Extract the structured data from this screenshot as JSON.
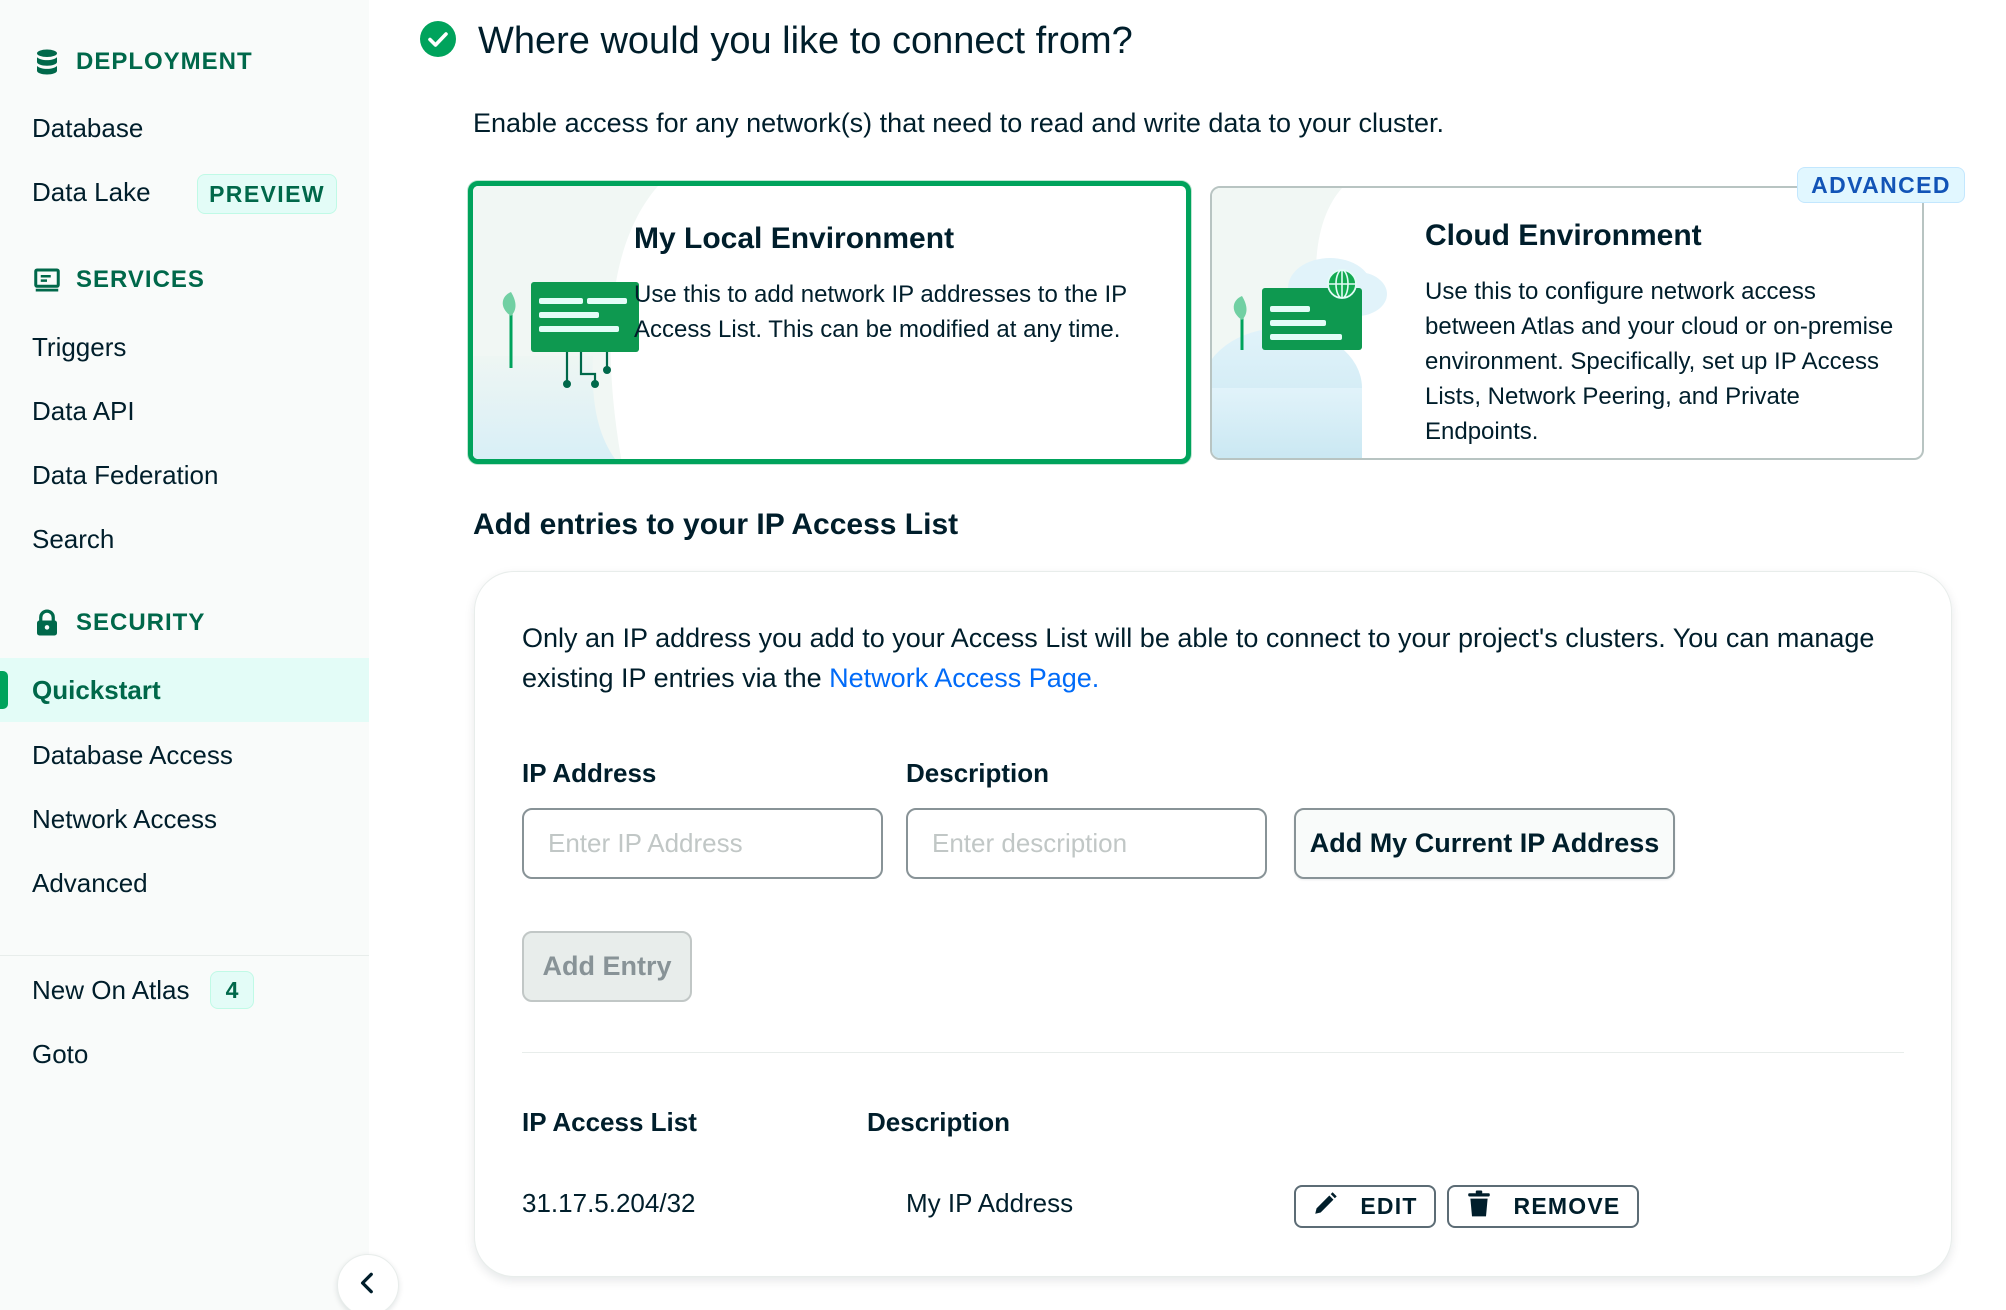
{
  "sidebar": {
    "sections": [
      {
        "label": "DEPLOYMENT",
        "icon": "database-stack-icon"
      },
      {
        "label": "SERVICES",
        "icon": "services-icon"
      },
      {
        "label": "SECURITY",
        "icon": "lock-icon"
      }
    ],
    "deployment_items": [
      {
        "label": "Database"
      },
      {
        "label": "Data Lake",
        "badge": "PREVIEW"
      }
    ],
    "services_items": [
      {
        "label": "Triggers"
      },
      {
        "label": "Data API"
      },
      {
        "label": "Data Federation"
      },
      {
        "label": "Search"
      }
    ],
    "security_items": [
      {
        "label": "Quickstart",
        "active": true
      },
      {
        "label": "Database Access"
      },
      {
        "label": "Network Access"
      },
      {
        "label": "Advanced"
      }
    ],
    "extra_items": [
      {
        "label": "New On Atlas",
        "count": "4"
      },
      {
        "label": "Goto"
      }
    ],
    "collapse_icon": "chevron-left-icon"
  },
  "main": {
    "title": "Where would you like to connect from?",
    "title_icon": "check-circle-icon",
    "subtitle": "Enable access for any network(s) that need to read and write data to your cluster.",
    "options": [
      {
        "title": "My Local Environment",
        "body": "Use this to add network IP addresses to the IP Access List. This can be modified at any time.",
        "selected": true
      },
      {
        "title": "Cloud Environment",
        "body": "Use this to configure network access between Atlas and your cloud or on-premise environment. Specifically, set up IP Access Lists, Network Peering, and Private Endpoints.",
        "badge": "ADVANCED",
        "selected": false
      }
    ],
    "access_section": {
      "title": "Add entries to your IP Access List",
      "intro_text": "Only an IP address you add to your Access List will be able to connect to your project's clusters. You can manage existing IP entries via the ",
      "intro_link": "Network Access Page.",
      "ip_label": "IP Address",
      "ip_placeholder": "Enter IP Address",
      "desc_label": "Description",
      "desc_placeholder": "Enter description",
      "current_ip_button": "Add My Current IP Address",
      "add_entry_button": "Add Entry",
      "list_headers": {
        "ip": "IP Access List",
        "description": "Description"
      },
      "entries": [
        {
          "ip": "31.17.5.204/32",
          "description": "My IP Address",
          "edit": "EDIT",
          "remove": "REMOVE"
        }
      ]
    }
  },
  "colors": {
    "brand_green": "#00684A",
    "selected_border": "#00A35C",
    "link_blue": "#016BF8",
    "advanced_badge_text": "#1254B7"
  }
}
